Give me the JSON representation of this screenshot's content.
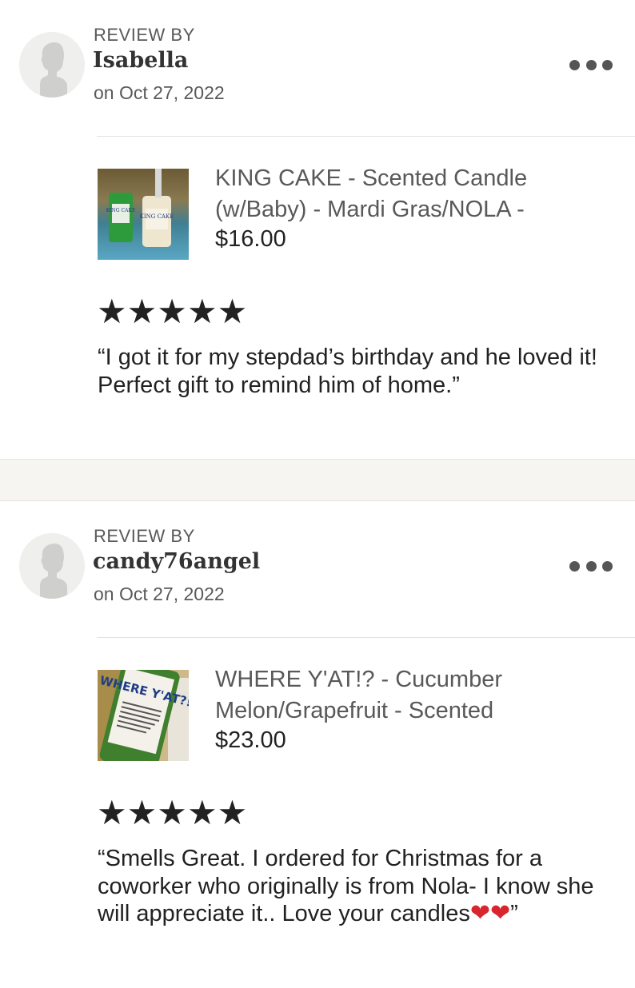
{
  "reviews": [
    {
      "review_by_label": "REVIEW BY",
      "reviewer_name": "Isabella",
      "date": "on Oct 27, 2022",
      "product_title": "KING CAKE - Scented Candle (w/Baby) - Mardi Gras/NOLA -",
      "price": "$16.00",
      "rating": 5,
      "stars": "★★★★★",
      "text": "“I got it for my stepdad’s birthday and he loved it! Perfect gift to remind him of home.”",
      "thumb_label_1": "KING CAKE",
      "thumb_label_2": "KING CAKE"
    },
    {
      "review_by_label": "REVIEW BY",
      "reviewer_name": "candy76angel",
      "date": "on Oct 27, 2022",
      "product_title": "WHERE Y'AT!? - Cucumber Melon/Grapefruit - Scented",
      "price": "$23.00",
      "rating": 5,
      "stars": "★★★★★",
      "text_before_hearts": "“Smells Great. I ordered for Christmas for a coworker who originally is from Nola- I know she will appreciate it.. Love your candles",
      "hearts": "❤❤",
      "text_after_hearts": "”",
      "thumb_label": "WHERE Y'AT?!"
    }
  ],
  "icons": {
    "more": "more-options-icon",
    "avatar": "default-user-avatar-icon",
    "star": "star-icon",
    "heart": "red-heart-emoji"
  },
  "colors": {
    "text_primary": "#222222",
    "text_secondary": "#595959",
    "separator_bg": "#f6f5f1",
    "heart": "#d9252d"
  }
}
